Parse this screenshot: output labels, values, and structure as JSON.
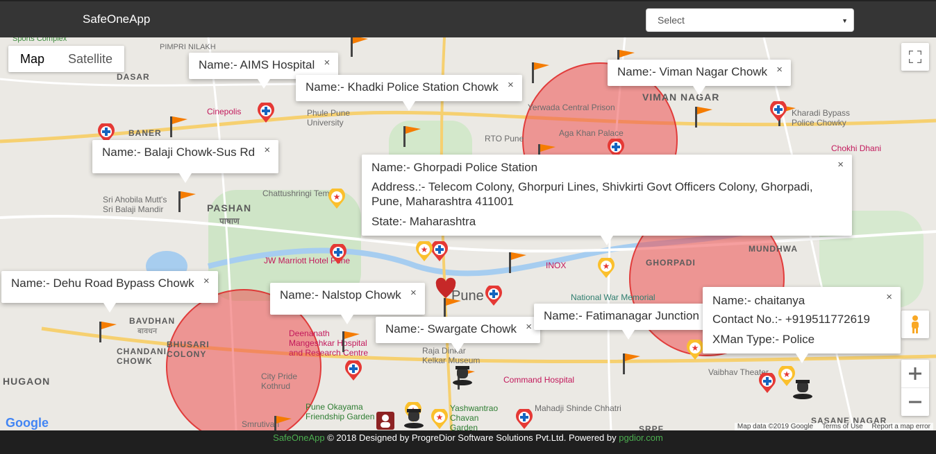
{
  "app": {
    "title": "SafeOneApp"
  },
  "header": {
    "select_value": "Select"
  },
  "map": {
    "type_controls": [
      "Map",
      "Satellite"
    ],
    "active_type": "Map",
    "google_logo": "Google",
    "attribution": [
      "Map data ©2019 Google",
      "Terms of Use",
      "Report a map error"
    ],
    "area_labels": {
      "pimpri_nilakh": "PIMPRI NILAKH",
      "dasar": "DASAR",
      "baner": "BANER",
      "pashan": "PASHAN",
      "pashan_local": "पाषाण",
      "viman_nagar": "VIMAN NAGAR",
      "bavdhan": "BAVDHAN",
      "bavdhan_local": "बावधन",
      "bhusari_colony": "BHUSARI COLONY",
      "chandani_chowk": "CHANDANI CHOWK",
      "hugaon": "HUGAON",
      "ghorpadi": "GHORPADI",
      "mundhwa": "MUNDHWA",
      "pune": "Pune",
      "sasane_nagar": "SASANE NAGAR",
      "srpf": "SRPF"
    },
    "poi_labels": {
      "cinepolis": "Cinepolis",
      "phule_pune_university": "Phule Pune University",
      "rto_pune": "RTO Pune",
      "yerwada_prison": "Yerwada Central Prison",
      "aga_khan_palace": "Aga Khan Palace",
      "kharadi_bypass": "Kharadi Bypass Police Chowky",
      "chokhi_dhani": "Chokhi Dhani",
      "chattushringi": "Chattushringi Temple",
      "sri_ahobila": "Sri Ahobila Mutt's Sri Balaji Mandir",
      "jw_marriott": "JW Marriott Hotel Pune",
      "inox": "INOX",
      "national_war_memorial": "National War Memorial",
      "deenanath": "Deenanath Mangeshkar Hospital and Research Centre",
      "city_pride": "City Pride Kothrud",
      "raja_dinkar": "Raja Dinkar Kelkar Museum",
      "command_hospital": "Command Hospital",
      "vaibhav_theater": "Vaibhav Theater",
      "yashwantrao": "Yashwantrao Chavan Garden",
      "mahadji": "Mahadji Shinde Chhatri",
      "pune_okayama": "Pune Okayama Friendship Garden",
      "smrutivan": "Smrutivan",
      "sports_complex": "Sports Complex"
    },
    "info_windows": [
      {
        "id": "aims",
        "lines": [
          "Name:- AIMS Hospital"
        ]
      },
      {
        "id": "khadki",
        "lines": [
          "Name:- Khadki Police Station Chowk"
        ]
      },
      {
        "id": "viman",
        "lines": [
          "Name:- Viman Nagar Chowk"
        ]
      },
      {
        "id": "balaji",
        "lines": [
          "Name:- Balaji Chowk-Sus Rd"
        ]
      },
      {
        "id": "ghorpadi",
        "lines": [
          "Name:- Ghorpadi Police Station",
          "Address.:- Telecom Colony, Ghorpuri Lines, Shivkirti Govt Officers Colony, Ghorpadi, Pune, Maharashtra 411001",
          "State:- Maharashtra"
        ]
      },
      {
        "id": "dehu",
        "lines": [
          "Name:- Dehu Road Bypass Chowk"
        ]
      },
      {
        "id": "nalstop",
        "lines": [
          "Name:- Nalstop Chowk"
        ]
      },
      {
        "id": "swargate",
        "lines": [
          "Name:- Swargate Chowk"
        ]
      },
      {
        "id": "fatimanagar",
        "lines": [
          "Name:- Fatimanagar Junction"
        ]
      },
      {
        "id": "chaitanya",
        "lines": [
          "Name:- chaitanya",
          "Contact No.:- +919511772619",
          "XMan Type:- Police"
        ]
      }
    ],
    "close_glyph": "×"
  },
  "footer": {
    "brand": "SafeOneApp",
    "text": " © 2018 Designed by ProgreDior Software Solutions Pvt.Ltd. Powered by ",
    "link": "pgdior.com"
  },
  "colors": {
    "header_bg": "#353535",
    "footer_bg": "#1f1f1f",
    "accent_green": "#4caf50",
    "circle_fill": "#ee5050",
    "flag": "#f57c00"
  },
  "icons": [
    "fullscreen-icon",
    "pegman-icon",
    "zoom-in-icon",
    "zoom-out-icon",
    "flag-marker-icon",
    "hospital-marker-icon",
    "star-marker-icon",
    "police-marker-icon",
    "heart-marker-icon"
  ]
}
